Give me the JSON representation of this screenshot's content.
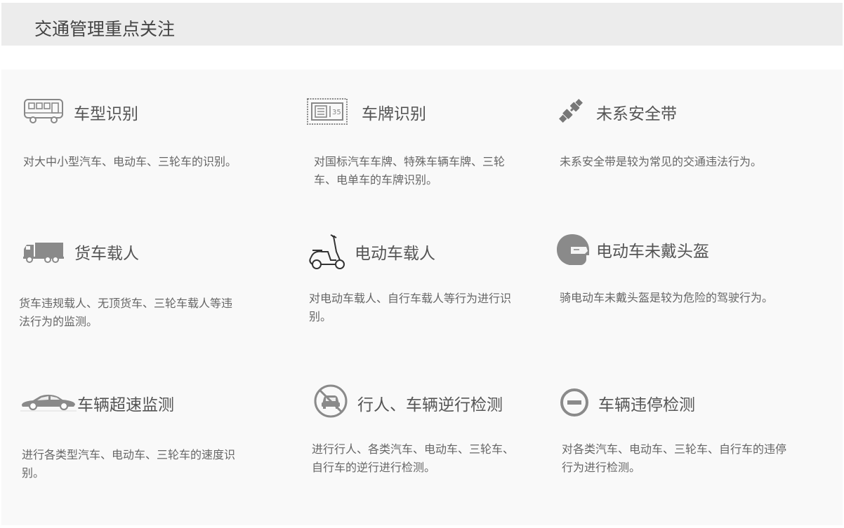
{
  "header": {
    "title": "交通管理重点关注"
  },
  "features": [
    {
      "icon": "bus-icon",
      "title": "车型识别",
      "desc": "对大中小型汽车、电动车、三轮车的识别。"
    },
    {
      "icon": "license-plate-icon",
      "title": "车牌识别",
      "desc": "对国标汽车车牌、特殊车辆车牌、三轮车、电单车的车牌识别。"
    },
    {
      "icon": "seatbelt-icon",
      "title": "未系安全带",
      "desc": "未系安全带是较为常见的交通违法行为。"
    },
    {
      "icon": "truck-icon",
      "title": "货车载人",
      "desc": "货车违规载人、无顶货车、三轮车载人等违法行为的监测。"
    },
    {
      "icon": "scooter-icon",
      "title": "电动车载人",
      "desc": "对电动车载人、自行车载人等行为进行识别。"
    },
    {
      "icon": "helmet-icon",
      "title": "电动车未戴头盔",
      "desc": "骑电动车未戴头盔是较为危险的驾驶行为。"
    },
    {
      "icon": "speeding-car-icon",
      "title": "车辆超速监测",
      "desc": "进行各类型汽车、电动车、三轮车的速度识别。"
    },
    {
      "icon": "no-car-icon",
      "title": "行人、车辆逆行检测",
      "desc": "进行行人、各类汽车、电动车、三轮车、自行车的逆行进行检测。"
    },
    {
      "icon": "no-entry-icon",
      "title": "车辆违停检测",
      "desc": "对各类汽车、电动车、三轮车、自行车的违停行为进行检测。"
    }
  ]
}
